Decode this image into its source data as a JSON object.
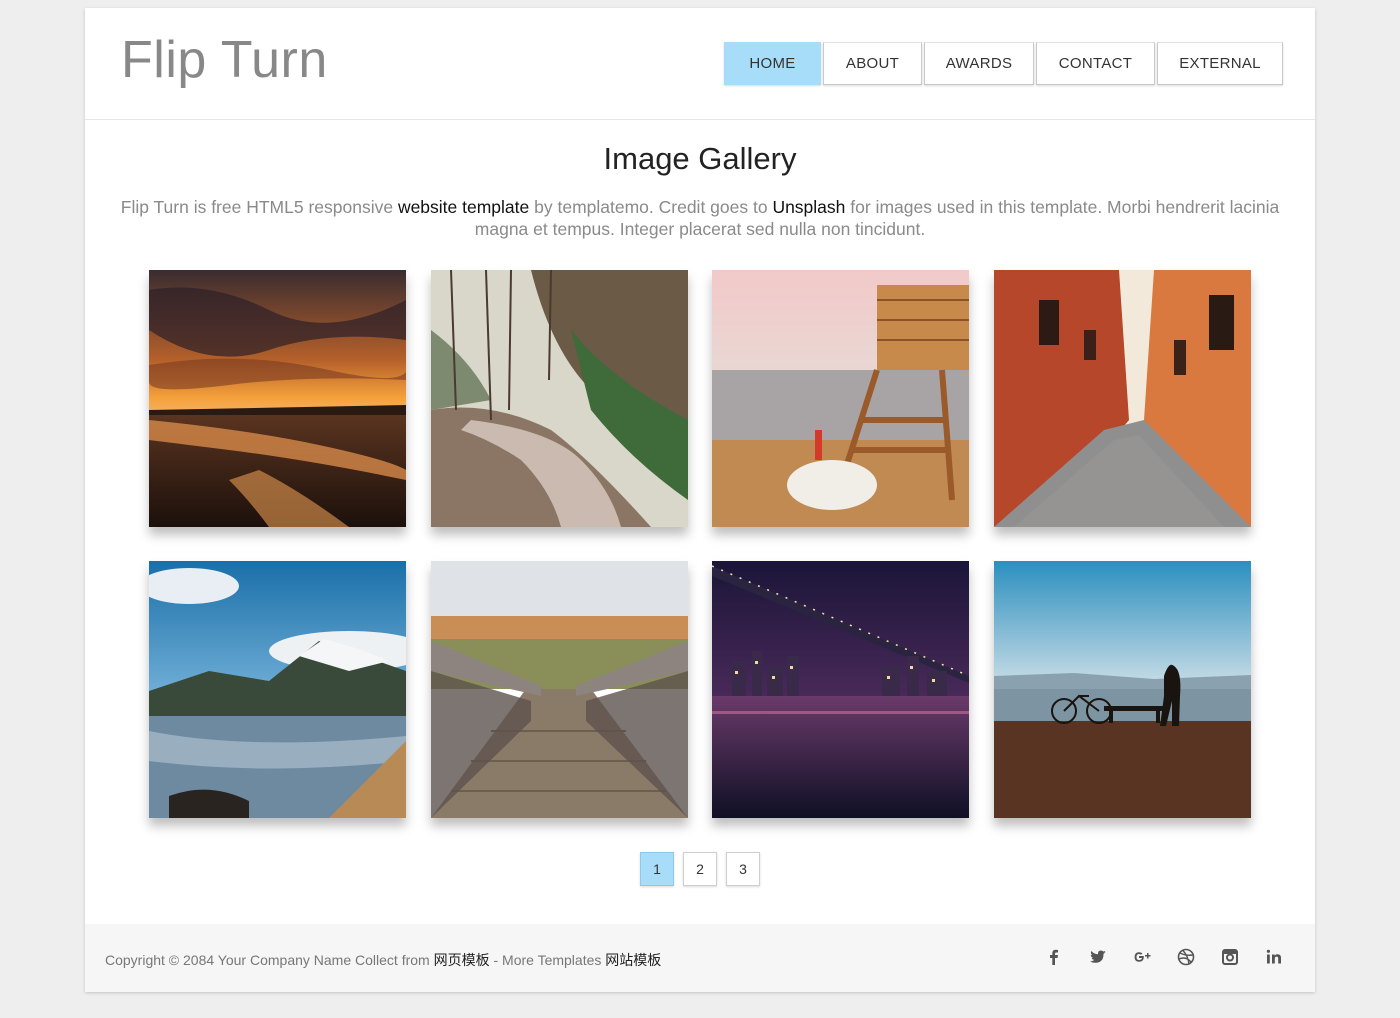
{
  "header": {
    "logo": "Flip Turn",
    "nav": [
      {
        "label": "HOME",
        "active": true
      },
      {
        "label": "ABOUT",
        "active": false
      },
      {
        "label": "AWARDS",
        "active": false
      },
      {
        "label": "CONTACT",
        "active": false
      },
      {
        "label": "EXTERNAL",
        "active": false
      }
    ]
  },
  "main": {
    "title": "Image Gallery",
    "desc_part1": "Flip Turn is free HTML5 responsive ",
    "desc_link1": "website template",
    "desc_part2": " by templatemo. Credit goes to ",
    "desc_link2": "Unsplash",
    "desc_part3": " for images used in this template. Morbi hendrerit lacinia magna et tempus. Integer placerat sed nulla non tincidunt."
  },
  "gallery": [
    {
      "name": "sunset-beach"
    },
    {
      "name": "forest-road"
    },
    {
      "name": "lifeguard-tower"
    },
    {
      "name": "narrow-alley"
    },
    {
      "name": "mountain-lake"
    },
    {
      "name": "wooden-bridge"
    },
    {
      "name": "city-bridge-night"
    },
    {
      "name": "seaside-bench"
    }
  ],
  "pagination": [
    {
      "label": "1",
      "active": true
    },
    {
      "label": "2",
      "active": false
    },
    {
      "label": "3",
      "active": false
    }
  ],
  "footer": {
    "copyright_text": "Copyright © 2084 Your Company Name Collect from ",
    "link1": "网页模板",
    "more_text": " - More Templates ",
    "link2": "网站模板",
    "social": [
      "facebook-icon",
      "twitter-icon",
      "google-plus-icon",
      "dribbble-icon",
      "instagram-icon",
      "linkedin-icon"
    ]
  },
  "colors": {
    "accent": "#a8ddfa",
    "logo": "#888888"
  }
}
